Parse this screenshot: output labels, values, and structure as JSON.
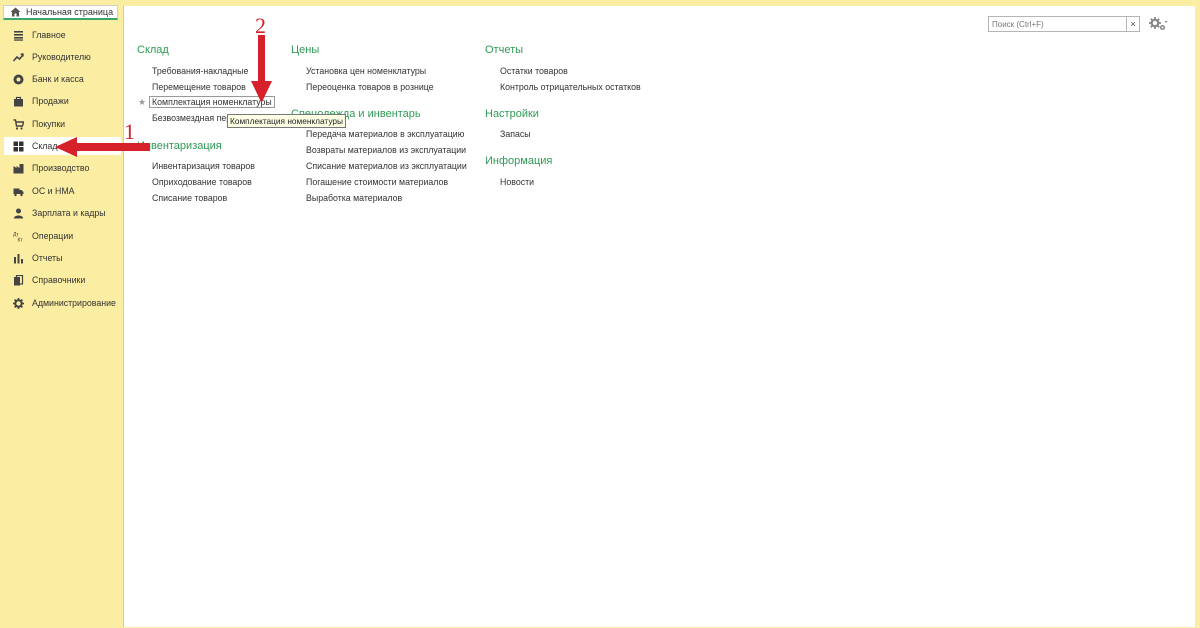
{
  "home_tab": {
    "label": "Начальная страница",
    "icon": "home-icon"
  },
  "sidebar": {
    "items": [
      {
        "label": "Главное",
        "icon": "menu-lines-icon",
        "active": false
      },
      {
        "label": "Руководителю",
        "icon": "trend-icon",
        "active": false
      },
      {
        "label": "Банк и касса",
        "icon": "coin-icon",
        "active": false
      },
      {
        "label": "Продажи",
        "icon": "bag-icon",
        "active": false
      },
      {
        "label": "Покупки",
        "icon": "cart-icon",
        "active": false
      },
      {
        "label": "Склад",
        "icon": "grid-icon",
        "active": true
      },
      {
        "label": "Производство",
        "icon": "factory-icon",
        "active": false
      },
      {
        "label": "ОС и НМА",
        "icon": "truck-icon",
        "active": false
      },
      {
        "label": "Зарплата и кадры",
        "icon": "person-icon",
        "active": false
      },
      {
        "label": "Операции",
        "icon": "dt-kt-icon",
        "active": false
      },
      {
        "label": "Отчеты",
        "icon": "bar-chart-icon",
        "active": false
      },
      {
        "label": "Справочники",
        "icon": "books-icon",
        "active": false
      },
      {
        "label": "Администрирование",
        "icon": "gear-icon",
        "active": false
      }
    ]
  },
  "search": {
    "placeholder": "Поиск (Ctrl+F)",
    "clear_label": "×"
  },
  "sections": {
    "sklad": {
      "title": "Склад",
      "links": [
        "Требования-накладные",
        "Перемещение товаров",
        "Комплектация номенклатуры",
        "Безвозмездная пер"
      ]
    },
    "inventarizaciya": {
      "title": "Инвентаризация",
      "links": [
        "Инвентаризация товаров",
        "Оприходование товаров",
        "Списание товаров"
      ]
    },
    "ceny": {
      "title": "Цены",
      "links": [
        "Установка цен номенклатуры",
        "Переоценка товаров в рознице"
      ]
    },
    "specodezhda": {
      "title": "Спецодежда и инвентарь",
      "links": [
        "Передача материалов в эксплуатацию",
        "Возвраты материалов из эксплуатации",
        "Списание материалов из эксплуатации",
        "Погашение стоимости материалов",
        "Выработка материалов"
      ]
    },
    "otchety": {
      "title": "Отчеты",
      "links": [
        "Остатки товаров",
        "Контроль отрицательных остатков"
      ]
    },
    "nastroiki": {
      "title": "Настройки",
      "links": [
        "Запасы"
      ]
    },
    "informaciya": {
      "title": "Информация",
      "links": [
        "Новости"
      ]
    }
  },
  "tooltip": {
    "text": "Комплектация номенклатуры"
  },
  "annotations": {
    "one": "1",
    "two": "2"
  },
  "colors": {
    "sidebar_bg": "#fbeea3",
    "section_title": "#2e9a55",
    "annotation_red": "#d6202a"
  }
}
